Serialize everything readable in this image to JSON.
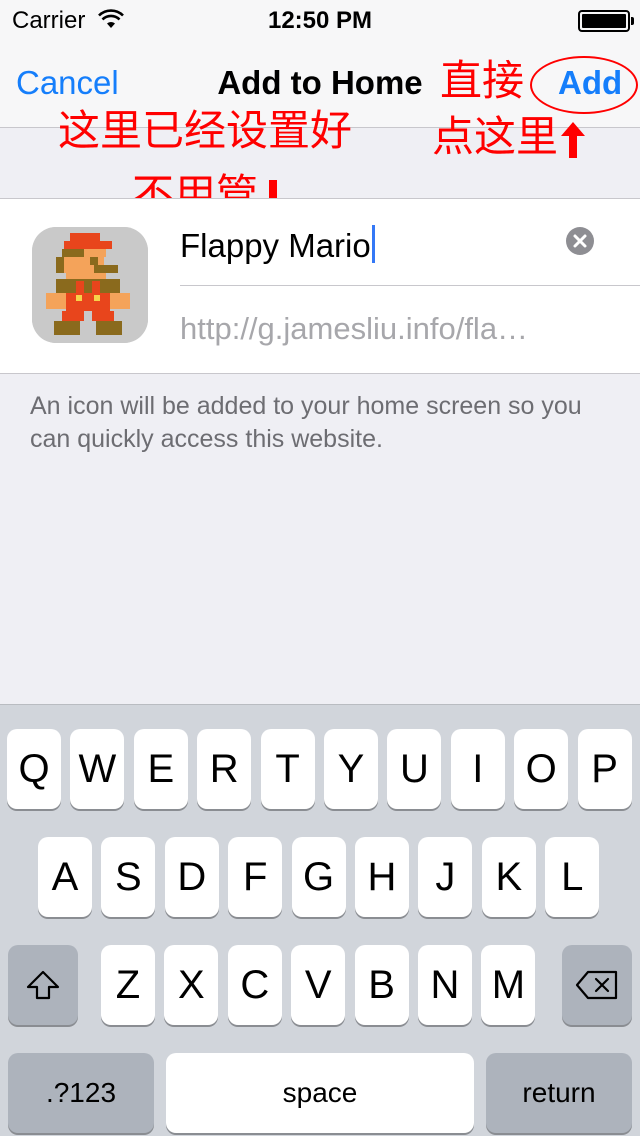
{
  "status_bar": {
    "carrier": "Carrier",
    "time": "12:50 PM"
  },
  "nav": {
    "cancel": "Cancel",
    "title": "Add to Home",
    "add": "Add"
  },
  "annotations": {
    "line1": "这里已经设置好",
    "line2": "不用管",
    "line3": "直接",
    "line4": "点这里"
  },
  "form": {
    "name_value": "Flappy Mario",
    "url_value": "http://g.jamesliu.info/fla…",
    "icon": "mario-app-icon"
  },
  "footnote": "An icon will be added to your home screen so you can quickly access this website.",
  "keyboard": {
    "row1": [
      "Q",
      "W",
      "E",
      "R",
      "T",
      "Y",
      "U",
      "I",
      "O",
      "P"
    ],
    "row2": [
      "A",
      "S",
      "D",
      "F",
      "G",
      "H",
      "J",
      "K",
      "L"
    ],
    "row3": [
      "Z",
      "X",
      "C",
      "V",
      "B",
      "N",
      "M"
    ],
    "shift_icon": "shift-icon",
    "delete_icon": "backspace-icon",
    "numbers": ".?123",
    "space": "space",
    "return": "return"
  },
  "colors": {
    "accent": "#157efb",
    "annotation": "#ff0000"
  }
}
